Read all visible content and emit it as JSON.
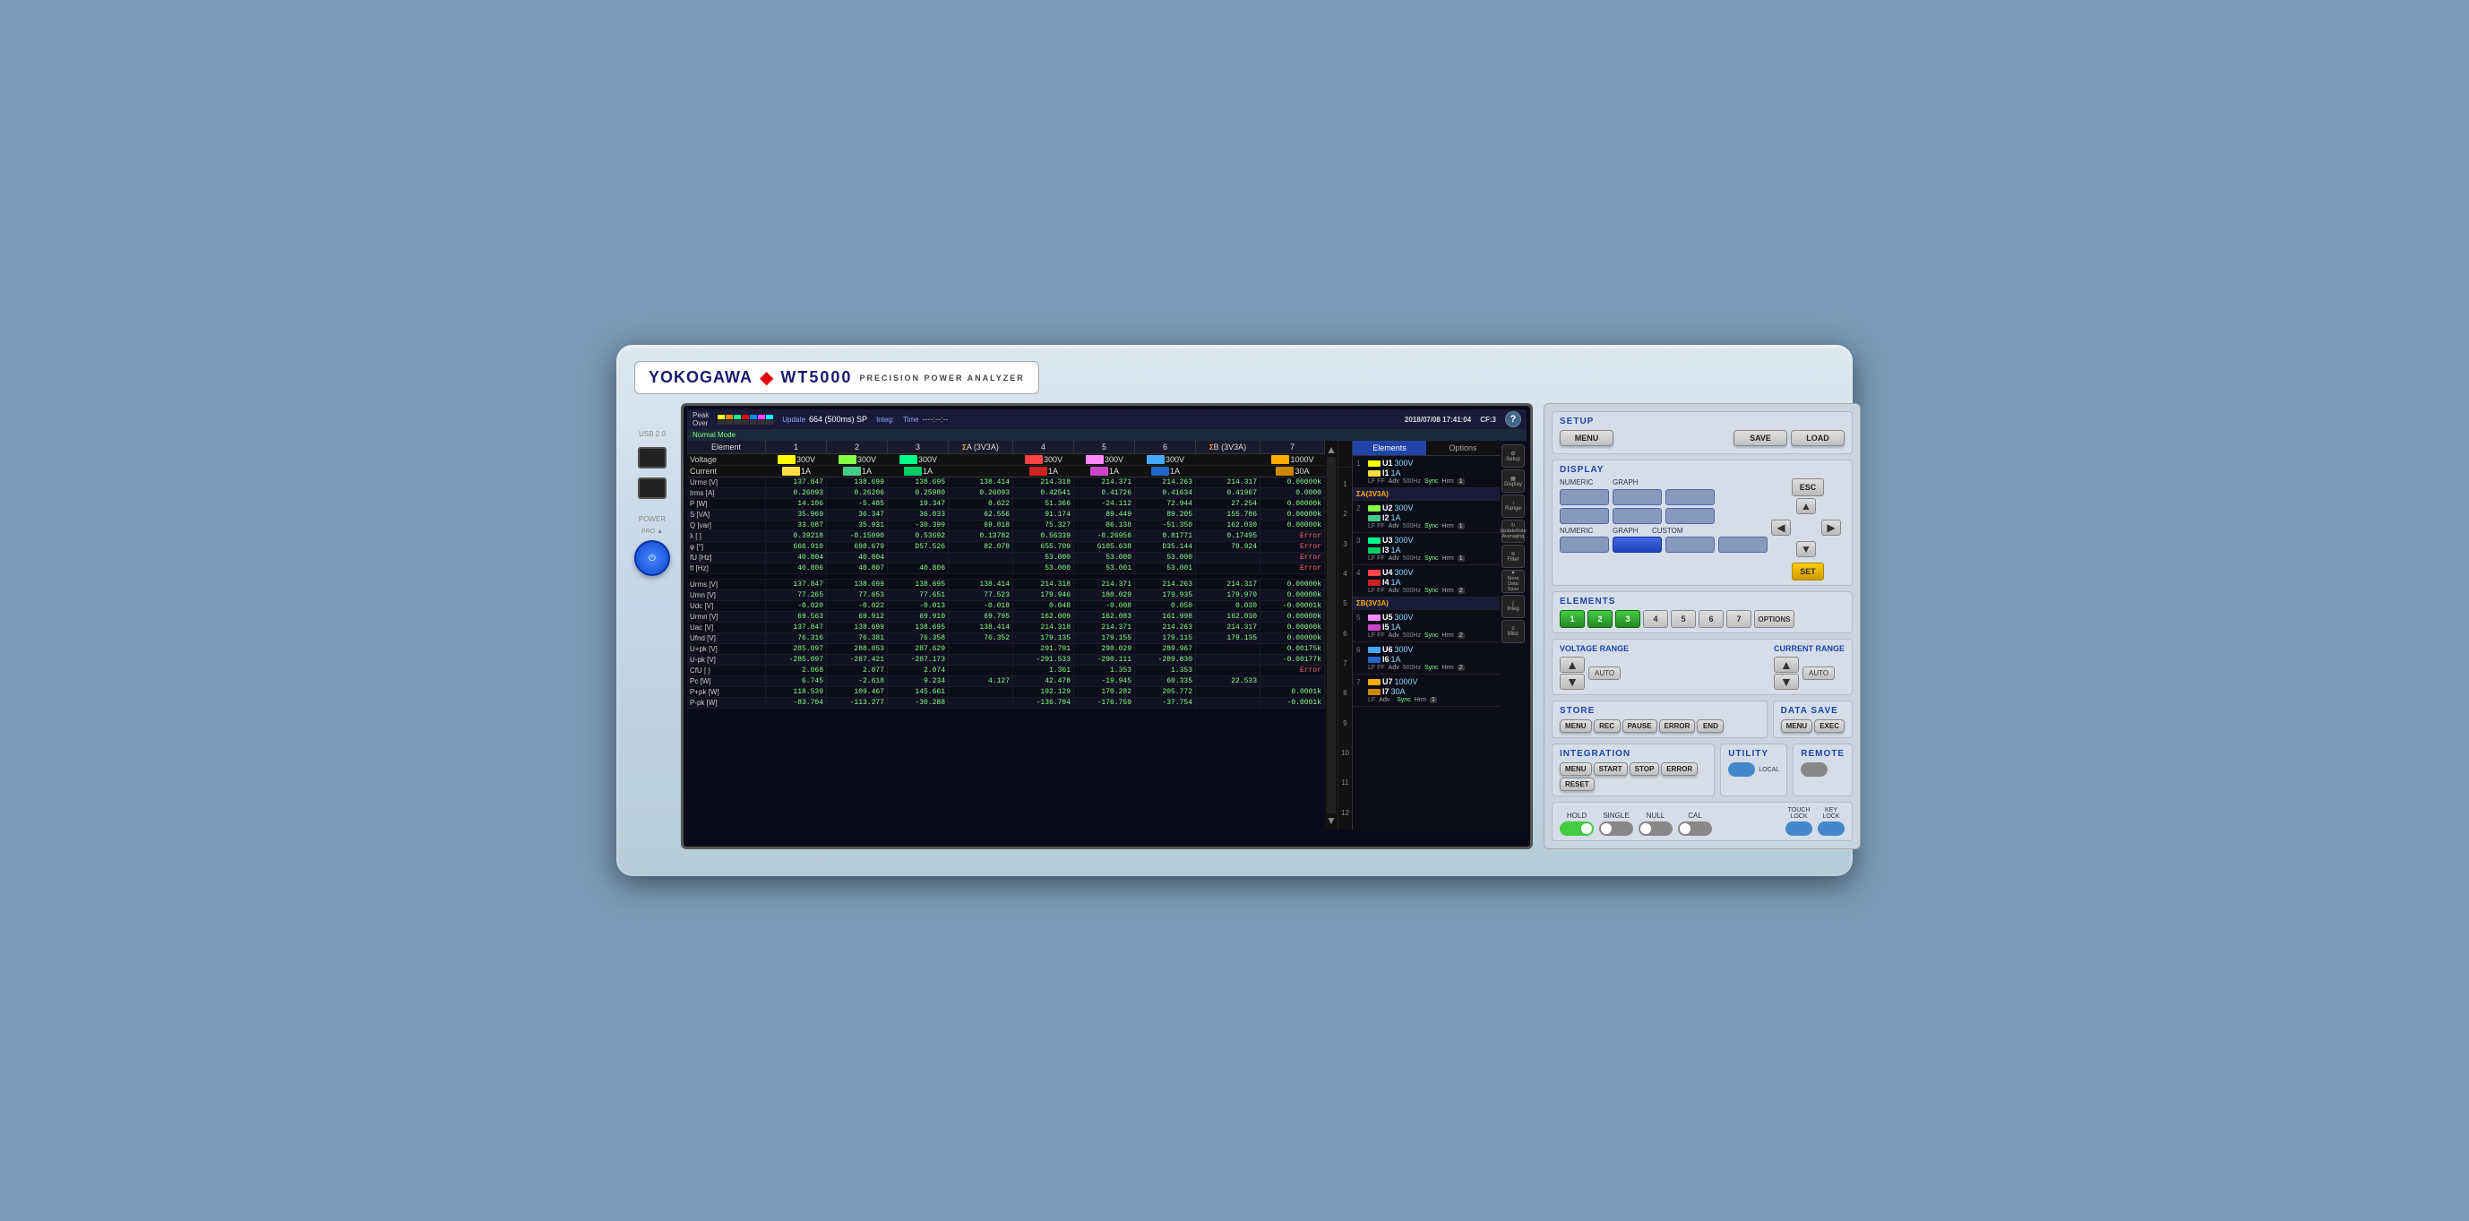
{
  "brand": {
    "name": "YOKOGAWA",
    "model": "WT5000",
    "subtitle": "PRECISION  POWER  ANALYZER"
  },
  "screen": {
    "update_label": "Update",
    "update_value": "664 (500ms) SP",
    "integ_label": "Integ:",
    "time_label": "Time",
    "time_value": "----:--:--",
    "date": "2018/07/08 17:41:04",
    "cf": "CF:3",
    "mode": "Normal Mode",
    "peak_label": "Peak",
    "over_label": "Over",
    "color_bars_top": [
      "#ffff00",
      "#ff8800",
      "#00ff88",
      "#ff0000",
      "#0088ff",
      "#ff44ff",
      "#00ffff"
    ],
    "color_bars_bot": [
      "#ffff00",
      "#ff8800",
      "#00ff88",
      "#ff0000",
      "#0088ff",
      "#ff44ff",
      "#00ffff"
    ],
    "tabs": [
      "Elements",
      "Options"
    ],
    "active_tab": "Elements"
  },
  "table": {
    "headers": [
      "Element",
      "1",
      "2",
      "3",
      "ΣA(3V3A)",
      "4",
      "5",
      "6",
      "ΣB(3V3A)",
      "7"
    ],
    "voltage_row": {
      "label": "Voltage",
      "colors": [
        "#ffff00",
        "#88ff44",
        "#00ff88",
        "",
        "#ff4444",
        "#ff88ff",
        "#44aaff",
        "",
        "#ffaa00"
      ],
      "values": [
        "300V",
        "300V",
        "300V",
        "",
        "300V",
        "300V",
        "300V",
        "",
        "1000V"
      ]
    },
    "current_row": {
      "label": "Current",
      "colors": [
        "#ffff00",
        "#88ff44",
        "#00ff88",
        "",
        "#ff4444",
        "#ff88ff",
        "#44aaff",
        "",
        "#ffaa00"
      ],
      "values": [
        "1A",
        "1A",
        "1A",
        "",
        "1A",
        "1A",
        "1A",
        "",
        "30A"
      ]
    },
    "rows": [
      {
        "label": "Urms [V]",
        "v1": "137.847",
        "v2": "138.699",
        "v3": "138.695",
        "vsa": "138.414",
        "v4": "214.318",
        "v5": "214.371",
        "v6": "214.263",
        "vsb": "214.317",
        "v7": "0.00000k",
        "err": false
      },
      {
        "label": "Irms [A]",
        "v1": "0.26093",
        "v2": "0.26206",
        "v3": "0.25980",
        "vsa": "0.26093",
        "v4": "0.42541",
        "v5": "0.41726",
        "v6": "0.41634",
        "vsb": "0.41967",
        "v7": "0.0000",
        "err": false
      },
      {
        "label": "P  [W]",
        "v1": "14.106",
        "v2": "-5.485",
        "v3": "19.347",
        "vsa": "8.622",
        "v4": "51.366",
        "v5": "-24.112",
        "v6": "72.944",
        "vsb": "27.254",
        "v7": "0.00000k",
        "err": false
      },
      {
        "label": "S  [VA]",
        "v1": "35.969",
        "v2": "36.347",
        "v3": "36.033",
        "vsa": "62.556",
        "v4": "91.174",
        "v5": "89.449",
        "v6": "89.205",
        "vsb": "155.786",
        "v7": "0.00000k",
        "err": false
      },
      {
        "label": "Q  [var]",
        "v1": "33.087",
        "v2": "35.931",
        "v3": "-30.399",
        "vsa": "69.018",
        "v4": "75.327",
        "v5": "86.138",
        "v6": "-51.350",
        "vsb": "162.030",
        "v7": "0.00000k",
        "err": false
      },
      {
        "label": "λ  [  ]",
        "v1": "0.39218",
        "v2": "-0.15090",
        "v3": "0.53692",
        "vsa": "0.13782",
        "v4": "0.56339",
        "v5": "-0.26956",
        "v6": "0.81771",
        "vsb": "0.17495",
        "v7": "Error",
        "err": true
      },
      {
        "label": "φ  [°]",
        "v1": "666.910",
        "v2": "698.679",
        "v3": "D57.526",
        "vsa": "82.078",
        "v4": "655.709",
        "v5": "G105.638",
        "v6": "D35.144",
        "vsb": "79.924",
        "v7": "Error",
        "err": true
      },
      {
        "label": "fU [Hz]",
        "v1": "40.804",
        "v2": "40.804",
        "v3": "",
        "vsa": "",
        "v4": "53.000",
        "v5": "53.000",
        "v6": "53.000",
        "vsb": "",
        "v7": "Error",
        "err": true
      },
      {
        "label": "fI [Hz]",
        "v1": "40.806",
        "v2": "40.807",
        "v3": "40.806",
        "vsa": "",
        "v4": "53.000",
        "v5": "53.001",
        "v6": "53.001",
        "vsb": "",
        "v7": "Error",
        "err": true
      },
      {
        "label": "",
        "v1": "",
        "v2": "",
        "v3": "",
        "vsa": "",
        "v4": "",
        "v5": "",
        "v6": "",
        "vsb": "",
        "v7": "",
        "err": false
      },
      {
        "label": "Urms [V]",
        "v1": "137.847",
        "v2": "138.699",
        "v3": "138.695",
        "vsa": "138.414",
        "v4": "214.318",
        "v5": "214.371",
        "v6": "214.263",
        "vsb": "214.317",
        "v7": "0.00000k",
        "err": false
      },
      {
        "label": "Umn  [V]",
        "v1": "77.265",
        "v2": "77.653",
        "v3": "77.651",
        "vsa": "77.523",
        "v4": "179.946",
        "v5": "180.029",
        "v6": "179.935",
        "vsb": "179.970",
        "v7": "0.00000k",
        "err": false
      },
      {
        "label": "Udc  [V]",
        "v1": "-0.020",
        "v2": "-0.022",
        "v3": "-0.013",
        "vsa": "-0.018",
        "v4": "0.048",
        "v5": "-0.008",
        "v6": "0.050",
        "vsb": "0.030",
        "v7": "-0.00001k",
        "err": false
      },
      {
        "label": "Urmn [V]",
        "v1": "69.563",
        "v2": "69.912",
        "v3": "69.910",
        "vsa": "69.795",
        "v4": "162.009",
        "v5": "162.083",
        "v6": "161.998",
        "vsb": "162.030",
        "v7": "0.00000k",
        "err": false
      },
      {
        "label": "Uac  [V]",
        "v1": "137.847",
        "v2": "138.699",
        "v3": "138.695",
        "vsa": "138.414",
        "v4": "214.318",
        "v5": "214.371",
        "v6": "214.263",
        "vsb": "214.317",
        "v7": "0.00000k",
        "err": false
      },
      {
        "label": "Ufnd [V]",
        "v1": "76.316",
        "v2": "76.381",
        "v3": "76.358",
        "vsa": "76.352",
        "v4": "179.135",
        "v5": "179.155",
        "v6": "179.115",
        "vsb": "179.135",
        "v7": "0.00000k",
        "err": false
      },
      {
        "label": "U+pk [V]",
        "v1": "285.097",
        "v2": "288.053",
        "v3": "287.629",
        "vsa": "",
        "v4": "291.791",
        "v5": "290.029",
        "v6": "289.967",
        "vsb": "",
        "v7": "0.00175k",
        "err": false
      },
      {
        "label": "U-pk [V]",
        "v1": "-285.097",
        "v2": "-287.421",
        "v3": "-287.173",
        "vsa": "",
        "v4": "-291.533",
        "v5": "-290.111",
        "v6": "-289.830",
        "vsb": "",
        "v7": "-0.00177k",
        "err": false
      },
      {
        "label": "CfU [  ]",
        "v1": "2.068",
        "v2": "2.077",
        "v3": "2.074",
        "vsa": "",
        "v4": "1.361",
        "v5": "1.353",
        "v6": "1.353",
        "vsb": "",
        "v7": "Error",
        "err": true
      },
      {
        "label": "Pc  [W]",
        "v1": "6.745",
        "v2": "-2.618",
        "v3": "9.234",
        "vsa": "4.127",
        "v4": "42.478",
        "v5": "-19.945",
        "v6": "60.335",
        "vsb": "22.533",
        "v7": "",
        "err": false
      },
      {
        "label": "P+pk [W]",
        "v1": "118.539",
        "v2": "109.467",
        "v3": "145.661",
        "vsa": "",
        "v4": "192.129",
        "v5": "170.282",
        "v6": "205.772",
        "vsb": "",
        "v7": "0.0001k",
        "err": false
      },
      {
        "label": "P-pk [W]",
        "v1": "-83.704",
        "v2": "-113.277",
        "v3": "-30.288",
        "vsa": "",
        "v4": "-136.794",
        "v5": "-176.759",
        "v6": "-37.754",
        "vsb": "",
        "v7": "-0.0001k",
        "err": false
      }
    ]
  },
  "elements_panel": {
    "items": [
      {
        "num": "1",
        "u_label": "U1",
        "u_color": "#ffff00",
        "u_range": "300V",
        "i_label": "I1",
        "i_color": "#ff8800",
        "i_range": "1A",
        "lf_ff": "LF FF",
        "adv": "Adv",
        "hz": "500Hz",
        "sync": "Sync",
        "hrm": "Hrm",
        "badge": "1",
        "group": ""
      },
      {
        "num": "",
        "u_label": "",
        "u_color": "",
        "u_range": "",
        "i_label": "",
        "i_color": "",
        "i_range": "",
        "lf_ff": "",
        "adv": "",
        "hz": "",
        "sync": "",
        "hrm": "",
        "badge": "",
        "group": "ΣA(3V3A)"
      },
      {
        "num": "2",
        "u_label": "U2",
        "u_color": "#88ff44",
        "u_range": "300V",
        "i_label": "I2",
        "i_color": "#44cc88",
        "i_range": "1A",
        "lf_ff": "LF FF",
        "adv": "Adv",
        "hz": "500Hz",
        "sync": "Sync",
        "hrm": "Hrm",
        "badge": "1",
        "group": ""
      },
      {
        "num": "3",
        "u_label": "U3",
        "u_color": "#00ff88",
        "u_range": "300V",
        "i_label": "I3",
        "i_color": "#00cc66",
        "i_range": "1A",
        "lf_ff": "LF FF",
        "adv": "Adv",
        "hz": "500Hz",
        "sync": "Sync",
        "hrm": "Hrm",
        "badge": "1",
        "group": ""
      },
      {
        "num": "4",
        "u_label": "U4",
        "u_color": "#ff4444",
        "u_range": "300V",
        "i_label": "I4",
        "i_color": "#cc2222",
        "i_range": "1A",
        "lf_ff": "LF FF",
        "adv": "Adv",
        "hz": "500Hz",
        "sync": "Sync",
        "hrm": "Hrm",
        "badge": "2",
        "group": ""
      },
      {
        "num": "",
        "u_label": "",
        "u_color": "",
        "u_range": "",
        "i_label": "",
        "i_color": "",
        "i_range": "",
        "lf_ff": "",
        "adv": "",
        "hz": "",
        "sync": "",
        "hrm": "",
        "badge": "",
        "group": "ΣB(3V3A)"
      },
      {
        "num": "5",
        "u_label": "U5",
        "u_color": "#ff88ff",
        "u_range": "300V",
        "i_label": "I5",
        "i_color": "#cc44cc",
        "i_range": "1A",
        "lf_ff": "LF FF",
        "adv": "Adv",
        "hz": "500Hz",
        "sync": "Sync",
        "hrm": "Hrm",
        "badge": "2",
        "group": ""
      },
      {
        "num": "6",
        "u_label": "U6",
        "u_color": "#44aaff",
        "u_range": "300V",
        "i_label": "I6",
        "i_color": "#2266cc",
        "i_range": "1A",
        "lf_ff": "LF FF",
        "adv": "Adv",
        "hz": "500Hz",
        "sync": "Sync",
        "hrm": "Hrm",
        "badge": "2",
        "group": ""
      },
      {
        "num": "7",
        "u_label": "U7",
        "u_color": "#ffaa00",
        "u_range": "1000V",
        "i_label": "I7",
        "i_color": "#cc8800",
        "i_range": "30A",
        "lf_ff": "LF",
        "adv": "Adv",
        "hz": "",
        "sync": "Sync",
        "hrm": "Hrm",
        "badge": "1",
        "group": ""
      }
    ]
  },
  "sidebar_icons": [
    {
      "label": "Setup",
      "icon": "⚙"
    },
    {
      "label": "Display",
      "icon": "▦"
    },
    {
      "label": "Range",
      "icon": "↕"
    },
    {
      "label": "UpdateRate\nAveraging",
      "icon": "↻"
    },
    {
      "label": "Filter",
      "icon": "≋"
    },
    {
      "label": "Store\nData Save",
      "icon": "▼"
    },
    {
      "label": "Integration",
      "icon": "∫"
    },
    {
      "label": "Misc",
      "icon": "≡"
    }
  ],
  "control_panel": {
    "setup": {
      "title": "SETUP",
      "menu_label": "MENU",
      "save_label": "SAVE",
      "load_label": "LOAD"
    },
    "display": {
      "title": "DISPLAY",
      "numeric_label": "NUMERIC",
      "graph_label": "GRAPH",
      "custom_label": "CUSTOM",
      "esc_label": "ESC",
      "set_label": "SET"
    },
    "elements": {
      "title": "ELEMENTS",
      "buttons": [
        "1",
        "2",
        "3",
        "4",
        "5",
        "6",
        "7"
      ],
      "active": [
        1,
        2,
        3
      ],
      "options_label": "OPTIONS"
    },
    "voltage_range": {
      "title": "VOLTAGE RANGE",
      "auto_label": "AUTO"
    },
    "current_range": {
      "title": "CURRENT RANGE",
      "auto_label": "AUTO"
    },
    "store": {
      "title": "STORE",
      "buttons": [
        "MENU",
        "REC",
        "PAUSE",
        "ERROR",
        "END"
      ]
    },
    "data_save": {
      "title": "DATA SAVE",
      "buttons": [
        "MENU",
        "EXEC"
      ]
    },
    "integration": {
      "title": "INTEGRATION",
      "buttons": [
        "MENU",
        "START",
        "STOP",
        "ERROR",
        "RESET"
      ]
    },
    "utility": {
      "title": "UTILITY",
      "local_label": "LOCAL"
    },
    "remote": {
      "title": "REMOTE"
    },
    "bottom_row": {
      "hold_label": "HOLD",
      "single_label": "SINGLE",
      "null_label": "NULL",
      "cal_label": "CAL",
      "touch_lock_label": "TOUCH\nLOCK",
      "key_lock_label": "KEY\nLOCK"
    }
  }
}
